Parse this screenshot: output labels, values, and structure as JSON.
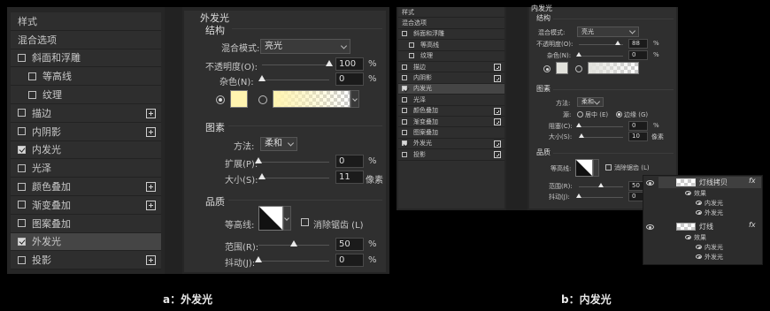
{
  "left": {
    "sidebar": {
      "items": [
        {
          "label": "样式",
          "checkbox": false,
          "checked": false,
          "plus": false,
          "indent": false,
          "selected": false
        },
        {
          "label": "混合选项",
          "checkbox": false,
          "checked": false,
          "plus": false,
          "indent": false,
          "selected": false
        },
        {
          "label": "斜面和浮雕",
          "checkbox": true,
          "checked": false,
          "plus": false,
          "indent": false,
          "selected": false
        },
        {
          "label": "等高线",
          "checkbox": true,
          "checked": false,
          "plus": false,
          "indent": true,
          "selected": false
        },
        {
          "label": "纹理",
          "checkbox": true,
          "checked": false,
          "plus": false,
          "indent": true,
          "selected": false
        },
        {
          "label": "描边",
          "checkbox": true,
          "checked": false,
          "plus": true,
          "indent": false,
          "selected": false
        },
        {
          "label": "内阴影",
          "checkbox": true,
          "checked": false,
          "plus": true,
          "indent": false,
          "selected": false
        },
        {
          "label": "内发光",
          "checkbox": true,
          "checked": true,
          "plus": false,
          "indent": false,
          "selected": false
        },
        {
          "label": "光泽",
          "checkbox": true,
          "checked": false,
          "plus": false,
          "indent": false,
          "selected": false
        },
        {
          "label": "颜色叠加",
          "checkbox": true,
          "checked": false,
          "plus": true,
          "indent": false,
          "selected": false
        },
        {
          "label": "渐变叠加",
          "checkbox": true,
          "checked": false,
          "plus": true,
          "indent": false,
          "selected": false
        },
        {
          "label": "图案叠加",
          "checkbox": true,
          "checked": false,
          "plus": false,
          "indent": false,
          "selected": false
        },
        {
          "label": "外发光",
          "checkbox": true,
          "checked": true,
          "plus": false,
          "indent": false,
          "selected": true
        },
        {
          "label": "投影",
          "checkbox": true,
          "checked": false,
          "plus": true,
          "indent": false,
          "selected": false
        }
      ]
    },
    "title": "外发光",
    "structure": {
      "header": "结构",
      "blend_label": "混合模式:",
      "blend_value": "亮光",
      "opacity_label": "不透明度(O):",
      "opacity_value": "100",
      "opacity_pct": 100,
      "noise_label": "杂色(N):",
      "noise_value": "0",
      "noise_pct": 0,
      "unit": "%",
      "color": "#fff4b0"
    },
    "elements": {
      "header": "图素",
      "method_label": "方法:",
      "method_value": "柔和",
      "spread_label": "扩展(P):",
      "spread_value": "0",
      "spread_pct": 0,
      "unit": "%",
      "size_label": "大小(S):",
      "size_value": "11",
      "size_pct": 5,
      "size_unit": "像素"
    },
    "quality": {
      "header": "品质",
      "contour_label": "等高线:",
      "antialias_label": "消除锯齿 (L)",
      "range_label": "范围(R):",
      "range_value": "50",
      "range_pct": 50,
      "jitter_label": "抖动(J):",
      "jitter_value": "0",
      "jitter_pct": 0,
      "unit": "%"
    },
    "caption": "a：外发光"
  },
  "right": {
    "sidebar": {
      "items": [
        {
          "label": "样式",
          "checkbox": false,
          "checked": false,
          "plus": false,
          "indent": false,
          "selected": false
        },
        {
          "label": "混合选项",
          "checkbox": false,
          "checked": false,
          "plus": false,
          "indent": false,
          "selected": false
        },
        {
          "label": "斜面和浮雕",
          "checkbox": true,
          "checked": false,
          "plus": false,
          "indent": false,
          "selected": false
        },
        {
          "label": "等高线",
          "checkbox": true,
          "checked": false,
          "plus": false,
          "indent": true,
          "selected": false
        },
        {
          "label": "纹理",
          "checkbox": true,
          "checked": false,
          "plus": false,
          "indent": true,
          "selected": false
        },
        {
          "label": "描边",
          "checkbox": true,
          "checked": false,
          "plus": true,
          "indent": false,
          "selected": false
        },
        {
          "label": "内阴影",
          "checkbox": true,
          "checked": false,
          "plus": true,
          "indent": false,
          "selected": false
        },
        {
          "label": "内发光",
          "checkbox": true,
          "checked": true,
          "plus": false,
          "indent": false,
          "selected": true
        },
        {
          "label": "光泽",
          "checkbox": true,
          "checked": false,
          "plus": false,
          "indent": false,
          "selected": false
        },
        {
          "label": "颜色叠加",
          "checkbox": true,
          "checked": false,
          "plus": true,
          "indent": false,
          "selected": false
        },
        {
          "label": "渐变叠加",
          "checkbox": true,
          "checked": false,
          "plus": true,
          "indent": false,
          "selected": false
        },
        {
          "label": "图案叠加",
          "checkbox": true,
          "checked": false,
          "plus": false,
          "indent": false,
          "selected": false
        },
        {
          "label": "外发光",
          "checkbox": true,
          "checked": true,
          "plus": true,
          "indent": false,
          "selected": false
        },
        {
          "label": "投影",
          "checkbox": true,
          "checked": false,
          "plus": true,
          "indent": false,
          "selected": false
        }
      ]
    },
    "title": "内发光",
    "structure": {
      "header": "结构",
      "blend_label": "混合模式:",
      "blend_value": "亮光",
      "opacity_label": "不透明度(O):",
      "opacity_value": "88",
      "opacity_pct": 88,
      "noise_label": "杂色(N):",
      "noise_value": "0",
      "noise_pct": 0,
      "unit": "%",
      "color": "#e2e2dc"
    },
    "elements": {
      "header": "图素",
      "method_label": "方法:",
      "method_value": "柔和",
      "source_label": "源:",
      "center_label": "居中 (E)",
      "edge_label": "边缘 (G)",
      "choke_label": "阻塞(C):",
      "choke_value": "0",
      "choke_pct": 0,
      "unit": "%",
      "size_label": "大小(S):",
      "size_value": "10",
      "size_pct": 5,
      "size_unit": "像素"
    },
    "quality": {
      "header": "品质",
      "contour_label": "等高线:",
      "antialias_label": "消除锯齿 (L)",
      "range_label": "范围(R):",
      "range_value": "50",
      "range_pct": 50,
      "jitter_label": "抖动(J):",
      "jitter_value": "0",
      "jitter_pct": 0
    },
    "caption": "b：内发光"
  },
  "layers": {
    "fx": "fx",
    "layer1": {
      "name": "灯线拷贝",
      "effects": "效果",
      "inner": "内发光",
      "outer": "外发光"
    },
    "layer2": {
      "name": "灯线",
      "effects": "效果",
      "inner": "内发光",
      "outer": "外发光"
    }
  }
}
